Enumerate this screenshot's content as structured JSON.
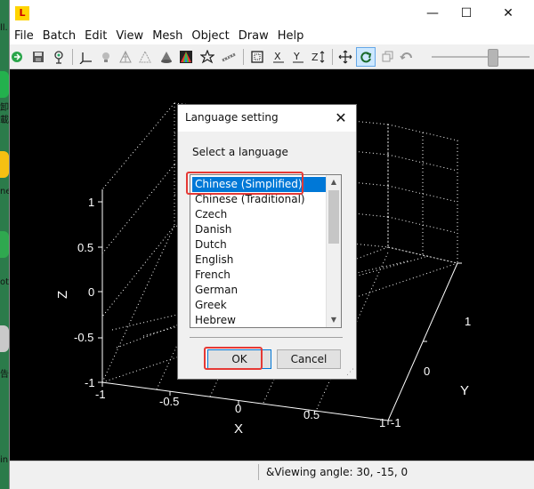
{
  "desktop": {
    "fragments": [
      "ll.",
      "卸",
      "載",
      "ne",
      "ot",
      "告",
      "in"
    ]
  },
  "window": {
    "controls": {
      "minimize": "—",
      "maximize": "☐",
      "close": "✕"
    }
  },
  "menu": [
    "File",
    "Batch",
    "Edit",
    "View",
    "Mesh",
    "Object",
    "Draw",
    "Help"
  ],
  "toolbar": {
    "icons": [
      "open-icon",
      "save-icon",
      "network-icon",
      "axes-icon",
      "light-icon",
      "wireframe-icon",
      "shaded-icon",
      "solid-icon",
      "colormap-icon",
      "star-icon",
      "ruler-icon",
      "box-icon",
      "xy-view-icon",
      "xz-view-icon",
      "z-view-icon",
      "move-icon",
      "rotate-icon",
      "sync-icon",
      "undo-icon"
    ],
    "zoom_level": 0.64
  },
  "plot": {
    "z_label": "Z",
    "x_label": "X",
    "y_label": "Y",
    "z_ticks": [
      "1",
      "0.5",
      "0",
      "-0.5",
      "-1"
    ],
    "x_ticks": [
      "-1",
      "-0.5",
      "0",
      "0.5",
      "1"
    ],
    "y_ticks": [
      "1",
      "0",
      "-1"
    ]
  },
  "dialog": {
    "title": "Language setting",
    "close_glyph": "✕",
    "prompt": "Select a language",
    "languages": [
      "Chinese (Simplified)",
      "Chinese (Traditional)",
      "Czech",
      "Danish",
      "Dutch",
      "English",
      "French",
      "German",
      "Greek",
      "Hebrew"
    ],
    "selected_index": 0,
    "ok_label": "OK",
    "cancel_label": "Cancel",
    "highlight_color": "#e53935",
    "selection_color": "#0078d7"
  },
  "status": {
    "text": "&Viewing angle: 30, -15, 0"
  }
}
